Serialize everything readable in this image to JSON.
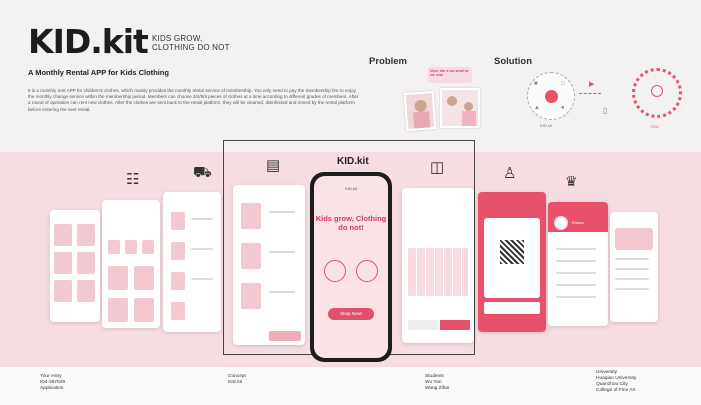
{
  "header": {
    "logo": "KID.kit",
    "tagline_1": "KIDS GROW,",
    "tagline_2": "CLOTHING DO NOT",
    "subtitle": "A Monthly Rental APP for Kids Clothing",
    "description": "It is a monthly rent APP for children's clothes, which mainly provides the monthly rental service of membership. You only need to pay the membership fee to enjoy the monthly change service within the membership period. Members can choose 3/4/5/6 pieces of clothes at a time according to different grades of members. After a round of operation can rent new clothes. After the clothes are sent back to the rental platform, they will be cleaned, disinfected and ironed by the rental platform before entering the next rental."
  },
  "problem": {
    "title": "Problem",
    "bubble": "Mom, this is too small for me now!"
  },
  "solution": {
    "title": "Solution",
    "left_label": "KID.kit",
    "right_label": "YOU"
  },
  "showcase": {
    "frame_title": "KID.kit",
    "phone_header": "KID.kit",
    "phone_headline": "Kids grow, Clothing do not!",
    "phone_button": "Shop Now!",
    "pickup_label": "Pick up 10:30",
    "profile_name": "Emma",
    "accent_color": "#e7516c",
    "soft_pink": "#f6dde2"
  },
  "icons": [
    "checklist-icon",
    "truck-icon",
    "hanger-icon",
    "calendar-icon",
    "user-icon",
    "crown-icon"
  ],
  "footer": {
    "col1_label": "Your entry",
    "col1_value1": "ID4-367649",
    "col1_value2": "Application",
    "col2_label": "Concept",
    "col2_value": "KID.kit",
    "col3_label": "Students",
    "col3_value1": "Wu Yan",
    "col3_value2": "Wang Zifan",
    "col4_label": "University",
    "col4_value1": "Huaqiao University",
    "col4_value2": "Quanzhou City",
    "col4_value3": "College of Fine Art"
  }
}
